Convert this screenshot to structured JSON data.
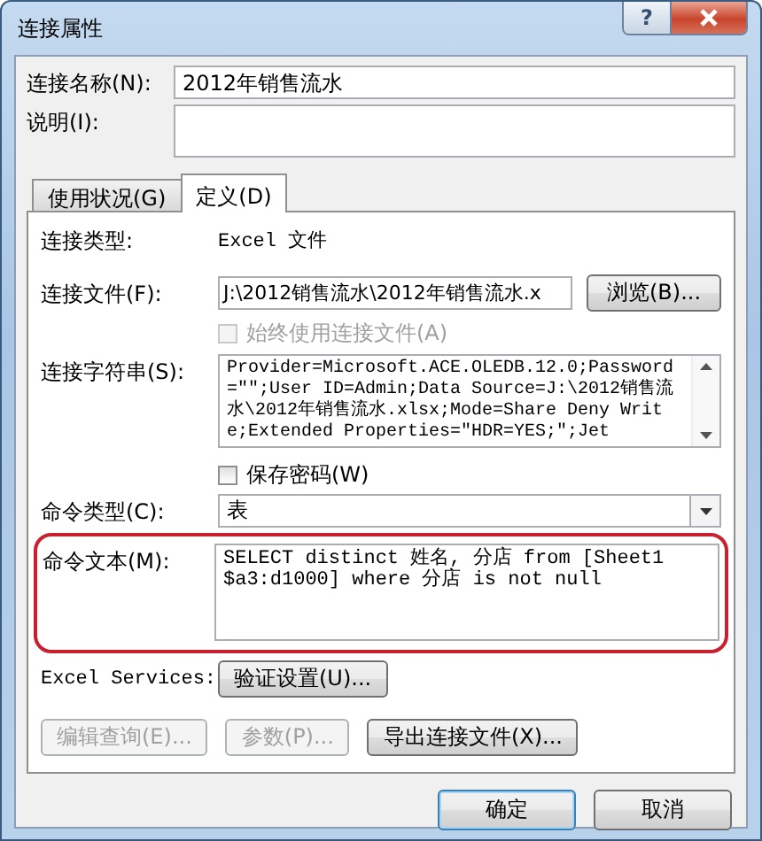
{
  "window": {
    "title": "连接属性",
    "help_button": "?"
  },
  "connection_name": {
    "label": "连接名称(N):",
    "value": "2012年销售流水"
  },
  "description": {
    "label": "说明(I):"
  },
  "tabs": [
    {
      "label": "使用状况(G)",
      "selected": false
    },
    {
      "label": "定义(D)",
      "selected": true
    }
  ],
  "definition": {
    "connection_type": {
      "label": "连接类型:",
      "value": "Excel 文件"
    },
    "connection_file": {
      "label": "连接文件(F):",
      "value": "J:\\2012销售流水\\2012年销售流水.x",
      "button": "浏览(B)..."
    },
    "always_use_file": {
      "label": "始终使用连接文件(A)",
      "checked": false,
      "disabled": true
    },
    "connection_string": {
      "label": "连接字符串(S):",
      "value": "Provider=Microsoft.ACE.OLEDB.12.0;Password=\"\";User ID=Admin;Data Source=J:\\2012销售流水\\2012年销售流水.xlsx;Mode=Share Deny Write;Extended Properties=\"HDR=YES;\";Jet"
    },
    "save_password": {
      "label": "保存密码(W)",
      "checked": false,
      "disabled": false
    },
    "command_type": {
      "label": "命令类型(C):",
      "value": "表"
    },
    "command_text": {
      "label": "命令文本(M):",
      "value": "SELECT distinct 姓名, 分店 from [Sheet1 $a3:d1000] where 分店 is not null",
      "highlighted": true
    },
    "excel_services": {
      "label": "Excel Services:",
      "button": "验证设置(U)..."
    },
    "actions": [
      {
        "label": "编辑查询(E)...",
        "disabled": true
      },
      {
        "label": "参数(P)...",
        "disabled": true
      },
      {
        "label": "导出连接文件(X)...",
        "disabled": false
      }
    ]
  },
  "footer_buttons": [
    {
      "label": "确定",
      "default": true
    },
    {
      "label": "取消",
      "default": false
    }
  ]
}
